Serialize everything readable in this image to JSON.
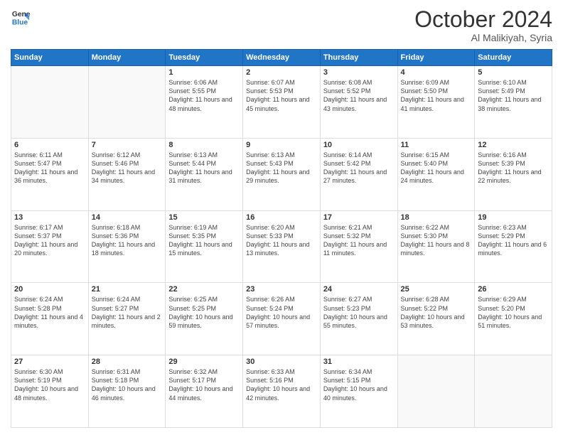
{
  "header": {
    "logo_line1": "General",
    "logo_line2": "Blue",
    "month_title": "October 2024",
    "subtitle": "Al Malikiyah, Syria"
  },
  "days_of_week": [
    "Sunday",
    "Monday",
    "Tuesday",
    "Wednesday",
    "Thursday",
    "Friday",
    "Saturday"
  ],
  "weeks": [
    [
      {
        "day": "",
        "info": ""
      },
      {
        "day": "",
        "info": ""
      },
      {
        "day": "1",
        "info": "Sunrise: 6:06 AM\nSunset: 5:55 PM\nDaylight: 11 hours and 48 minutes."
      },
      {
        "day": "2",
        "info": "Sunrise: 6:07 AM\nSunset: 5:53 PM\nDaylight: 11 hours and 45 minutes."
      },
      {
        "day": "3",
        "info": "Sunrise: 6:08 AM\nSunset: 5:52 PM\nDaylight: 11 hours and 43 minutes."
      },
      {
        "day": "4",
        "info": "Sunrise: 6:09 AM\nSunset: 5:50 PM\nDaylight: 11 hours and 41 minutes."
      },
      {
        "day": "5",
        "info": "Sunrise: 6:10 AM\nSunset: 5:49 PM\nDaylight: 11 hours and 38 minutes."
      }
    ],
    [
      {
        "day": "6",
        "info": "Sunrise: 6:11 AM\nSunset: 5:47 PM\nDaylight: 11 hours and 36 minutes."
      },
      {
        "day": "7",
        "info": "Sunrise: 6:12 AM\nSunset: 5:46 PM\nDaylight: 11 hours and 34 minutes."
      },
      {
        "day": "8",
        "info": "Sunrise: 6:13 AM\nSunset: 5:44 PM\nDaylight: 11 hours and 31 minutes."
      },
      {
        "day": "9",
        "info": "Sunrise: 6:13 AM\nSunset: 5:43 PM\nDaylight: 11 hours and 29 minutes."
      },
      {
        "day": "10",
        "info": "Sunrise: 6:14 AM\nSunset: 5:42 PM\nDaylight: 11 hours and 27 minutes."
      },
      {
        "day": "11",
        "info": "Sunrise: 6:15 AM\nSunset: 5:40 PM\nDaylight: 11 hours and 24 minutes."
      },
      {
        "day": "12",
        "info": "Sunrise: 6:16 AM\nSunset: 5:39 PM\nDaylight: 11 hours and 22 minutes."
      }
    ],
    [
      {
        "day": "13",
        "info": "Sunrise: 6:17 AM\nSunset: 5:37 PM\nDaylight: 11 hours and 20 minutes."
      },
      {
        "day": "14",
        "info": "Sunrise: 6:18 AM\nSunset: 5:36 PM\nDaylight: 11 hours and 18 minutes."
      },
      {
        "day": "15",
        "info": "Sunrise: 6:19 AM\nSunset: 5:35 PM\nDaylight: 11 hours and 15 minutes."
      },
      {
        "day": "16",
        "info": "Sunrise: 6:20 AM\nSunset: 5:33 PM\nDaylight: 11 hours and 13 minutes."
      },
      {
        "day": "17",
        "info": "Sunrise: 6:21 AM\nSunset: 5:32 PM\nDaylight: 11 hours and 11 minutes."
      },
      {
        "day": "18",
        "info": "Sunrise: 6:22 AM\nSunset: 5:30 PM\nDaylight: 11 hours and 8 minutes."
      },
      {
        "day": "19",
        "info": "Sunrise: 6:23 AM\nSunset: 5:29 PM\nDaylight: 11 hours and 6 minutes."
      }
    ],
    [
      {
        "day": "20",
        "info": "Sunrise: 6:24 AM\nSunset: 5:28 PM\nDaylight: 11 hours and 4 minutes."
      },
      {
        "day": "21",
        "info": "Sunrise: 6:24 AM\nSunset: 5:27 PM\nDaylight: 11 hours and 2 minutes."
      },
      {
        "day": "22",
        "info": "Sunrise: 6:25 AM\nSunset: 5:25 PM\nDaylight: 10 hours and 59 minutes."
      },
      {
        "day": "23",
        "info": "Sunrise: 6:26 AM\nSunset: 5:24 PM\nDaylight: 10 hours and 57 minutes."
      },
      {
        "day": "24",
        "info": "Sunrise: 6:27 AM\nSunset: 5:23 PM\nDaylight: 10 hours and 55 minutes."
      },
      {
        "day": "25",
        "info": "Sunrise: 6:28 AM\nSunset: 5:22 PM\nDaylight: 10 hours and 53 minutes."
      },
      {
        "day": "26",
        "info": "Sunrise: 6:29 AM\nSunset: 5:20 PM\nDaylight: 10 hours and 51 minutes."
      }
    ],
    [
      {
        "day": "27",
        "info": "Sunrise: 6:30 AM\nSunset: 5:19 PM\nDaylight: 10 hours and 48 minutes."
      },
      {
        "day": "28",
        "info": "Sunrise: 6:31 AM\nSunset: 5:18 PM\nDaylight: 10 hours and 46 minutes."
      },
      {
        "day": "29",
        "info": "Sunrise: 6:32 AM\nSunset: 5:17 PM\nDaylight: 10 hours and 44 minutes."
      },
      {
        "day": "30",
        "info": "Sunrise: 6:33 AM\nSunset: 5:16 PM\nDaylight: 10 hours and 42 minutes."
      },
      {
        "day": "31",
        "info": "Sunrise: 6:34 AM\nSunset: 5:15 PM\nDaylight: 10 hours and 40 minutes."
      },
      {
        "day": "",
        "info": ""
      },
      {
        "day": "",
        "info": ""
      }
    ]
  ]
}
